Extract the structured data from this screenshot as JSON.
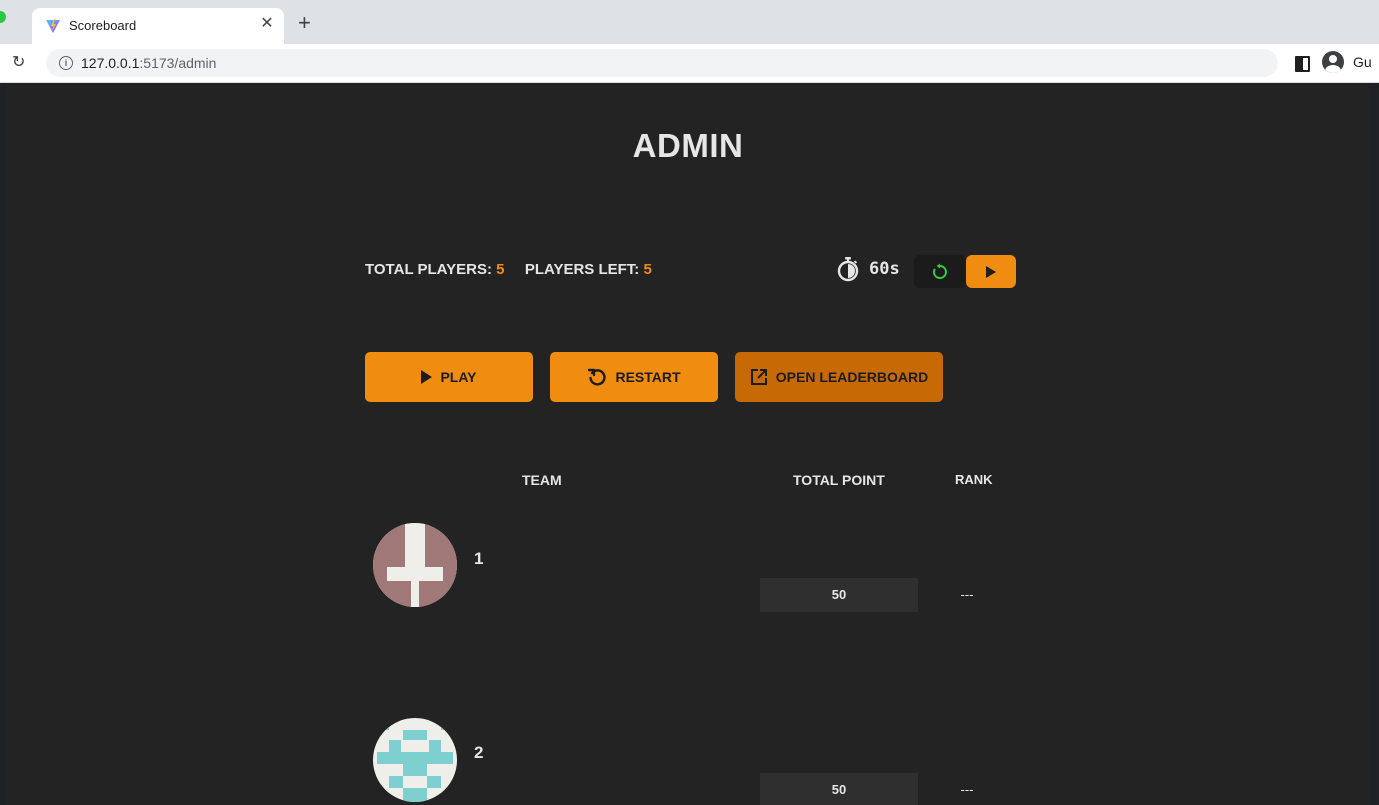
{
  "browser": {
    "tab_title": "Scoreboard",
    "url_host": "127.0.0.1",
    "url_rest": ":5173/admin",
    "profile_label": "Gu"
  },
  "page": {
    "title": "ADMIN",
    "stats": {
      "total_players_label": "TOTAL PLAYERS:",
      "total_players_value": "5",
      "players_left_label": "PLAYERS LEFT:",
      "players_left_value": "5"
    },
    "timer": {
      "value": "60s"
    },
    "buttons": {
      "play": "PLAY",
      "restart": "RESTART",
      "open_leaderboard": "OPEN LEADERBOARD"
    },
    "table": {
      "headers": {
        "team": "TEAM",
        "total_point": "TOTAL POINT",
        "rank": "RANK"
      },
      "rows": [
        {
          "team": "1",
          "points": "50",
          "rank": "---",
          "avatar_color": "#a07878"
        },
        {
          "team": "2",
          "points": "50",
          "rank": "---",
          "avatar_color": "#7ecfcf"
        }
      ]
    },
    "colors": {
      "accent": "#f08c0f",
      "accent_dark": "#c76a06",
      "background": "#232323",
      "reset_icon": "#2ecc40"
    }
  }
}
